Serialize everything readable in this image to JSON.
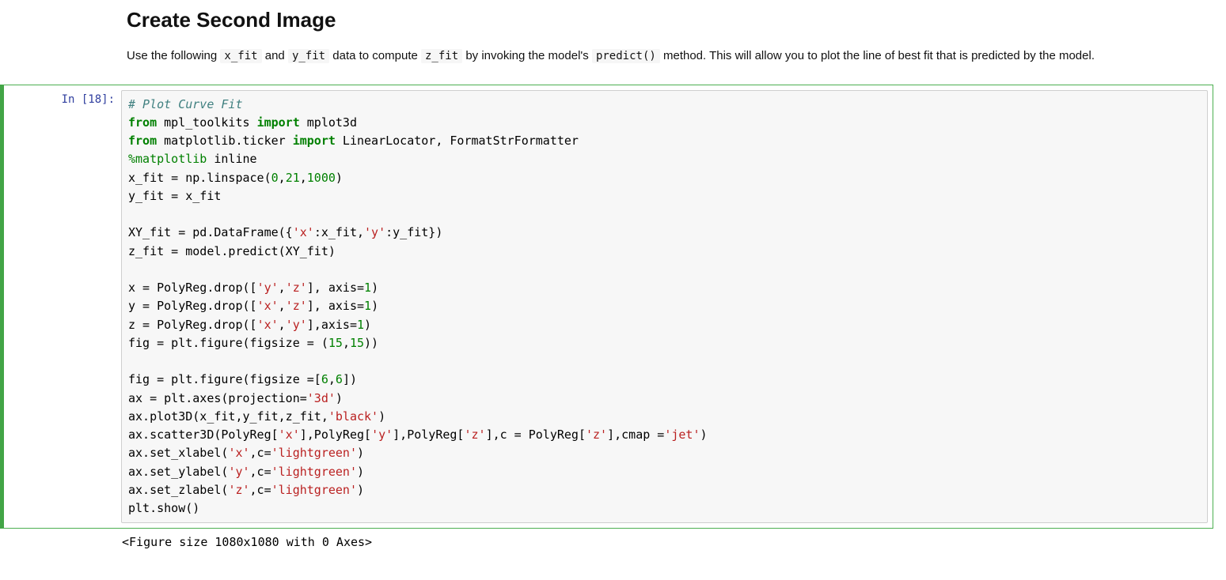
{
  "markdown": {
    "heading": "Create Second Image",
    "para_parts": [
      "Use the following ",
      "x_fit",
      " and ",
      "y_fit",
      " data to compute ",
      "z_fit",
      " by invoking the model's ",
      "predict()",
      " method. This will allow you to plot the line of best fit that is predicted by the model."
    ]
  },
  "code_cell": {
    "prompt": "In [18]:",
    "tokens": [
      {
        "c": "cm",
        "t": "# Plot Curve Fit"
      },
      {
        "t": "\n"
      },
      {
        "c": "kw",
        "t": "from"
      },
      {
        "t": " mpl_toolkits "
      },
      {
        "c": "kw",
        "t": "import"
      },
      {
        "t": " mplot3d\n"
      },
      {
        "c": "kw",
        "t": "from"
      },
      {
        "t": " matplotlib.ticker "
      },
      {
        "c": "kw",
        "t": "import"
      },
      {
        "t": " LinearLocator, FormatStrFormatter\n"
      },
      {
        "c": "mg",
        "t": "%"
      },
      {
        "c": "mg",
        "t": "matplotlib"
      },
      {
        "t": " inline\n"
      },
      {
        "t": "x_fit = np.linspace("
      },
      {
        "c": "num",
        "t": "0"
      },
      {
        "t": ","
      },
      {
        "c": "num",
        "t": "21"
      },
      {
        "t": ","
      },
      {
        "c": "num",
        "t": "1000"
      },
      {
        "t": ")\n"
      },
      {
        "t": "y_fit = x_fit\n"
      },
      {
        "t": "\n"
      },
      {
        "t": "XY_fit = pd.DataFrame({"
      },
      {
        "c": "str",
        "t": "'x'"
      },
      {
        "t": ":x_fit,"
      },
      {
        "c": "str",
        "t": "'y'"
      },
      {
        "t": ":y_fit})\n"
      },
      {
        "t": "z_fit = model.predict(XY_fit)\n"
      },
      {
        "t": "\n"
      },
      {
        "t": "x = PolyReg.drop(["
      },
      {
        "c": "str",
        "t": "'y'"
      },
      {
        "t": ","
      },
      {
        "c": "str",
        "t": "'z'"
      },
      {
        "t": "], axis="
      },
      {
        "c": "num",
        "t": "1"
      },
      {
        "t": ")\n"
      },
      {
        "t": "y = PolyReg.drop(["
      },
      {
        "c": "str",
        "t": "'x'"
      },
      {
        "t": ","
      },
      {
        "c": "str",
        "t": "'z'"
      },
      {
        "t": "], axis="
      },
      {
        "c": "num",
        "t": "1"
      },
      {
        "t": ")\n"
      },
      {
        "t": "z = PolyReg.drop(["
      },
      {
        "c": "str",
        "t": "'x'"
      },
      {
        "t": ","
      },
      {
        "c": "str",
        "t": "'y'"
      },
      {
        "t": "],axis="
      },
      {
        "c": "num",
        "t": "1"
      },
      {
        "t": ")\n"
      },
      {
        "t": "fig = plt.figure(figsize = ("
      },
      {
        "c": "num",
        "t": "15"
      },
      {
        "t": ","
      },
      {
        "c": "num",
        "t": "15"
      },
      {
        "t": "))\n"
      },
      {
        "t": "\n"
      },
      {
        "t": "fig = plt.figure(figsize =["
      },
      {
        "c": "num",
        "t": "6"
      },
      {
        "t": ","
      },
      {
        "c": "num",
        "t": "6"
      },
      {
        "t": "])\n"
      },
      {
        "t": "ax = plt.axes(projection="
      },
      {
        "c": "str",
        "t": "'3d'"
      },
      {
        "t": ")\n"
      },
      {
        "t": "ax.plot3D(x_fit,y_fit,z_fit,"
      },
      {
        "c": "str",
        "t": "'black'"
      },
      {
        "t": ")\n"
      },
      {
        "t": "ax.scatter3D(PolyReg["
      },
      {
        "c": "str",
        "t": "'x'"
      },
      {
        "t": "],PolyReg["
      },
      {
        "c": "str",
        "t": "'y'"
      },
      {
        "t": "],PolyReg["
      },
      {
        "c": "str",
        "t": "'z'"
      },
      {
        "t": "],c = PolyReg["
      },
      {
        "c": "str",
        "t": "'z'"
      },
      {
        "t": "],cmap ="
      },
      {
        "c": "str",
        "t": "'jet'"
      },
      {
        "t": ")\n"
      },
      {
        "t": "ax.set_xlabel("
      },
      {
        "c": "str",
        "t": "'x'"
      },
      {
        "t": ",c="
      },
      {
        "c": "str",
        "t": "'lightgreen'"
      },
      {
        "t": ")\n"
      },
      {
        "t": "ax.set_ylabel("
      },
      {
        "c": "str",
        "t": "'y'"
      },
      {
        "t": ",c="
      },
      {
        "c": "str",
        "t": "'lightgreen'"
      },
      {
        "t": ")\n"
      },
      {
        "t": "ax.set_zlabel("
      },
      {
        "c": "str",
        "t": "'z'"
      },
      {
        "t": ",c="
      },
      {
        "c": "str",
        "t": "'lightgreen'"
      },
      {
        "t": ")\n"
      },
      {
        "t": "plt.show()"
      }
    ],
    "output": "<Figure size 1080x1080 with 0 Axes>"
  }
}
